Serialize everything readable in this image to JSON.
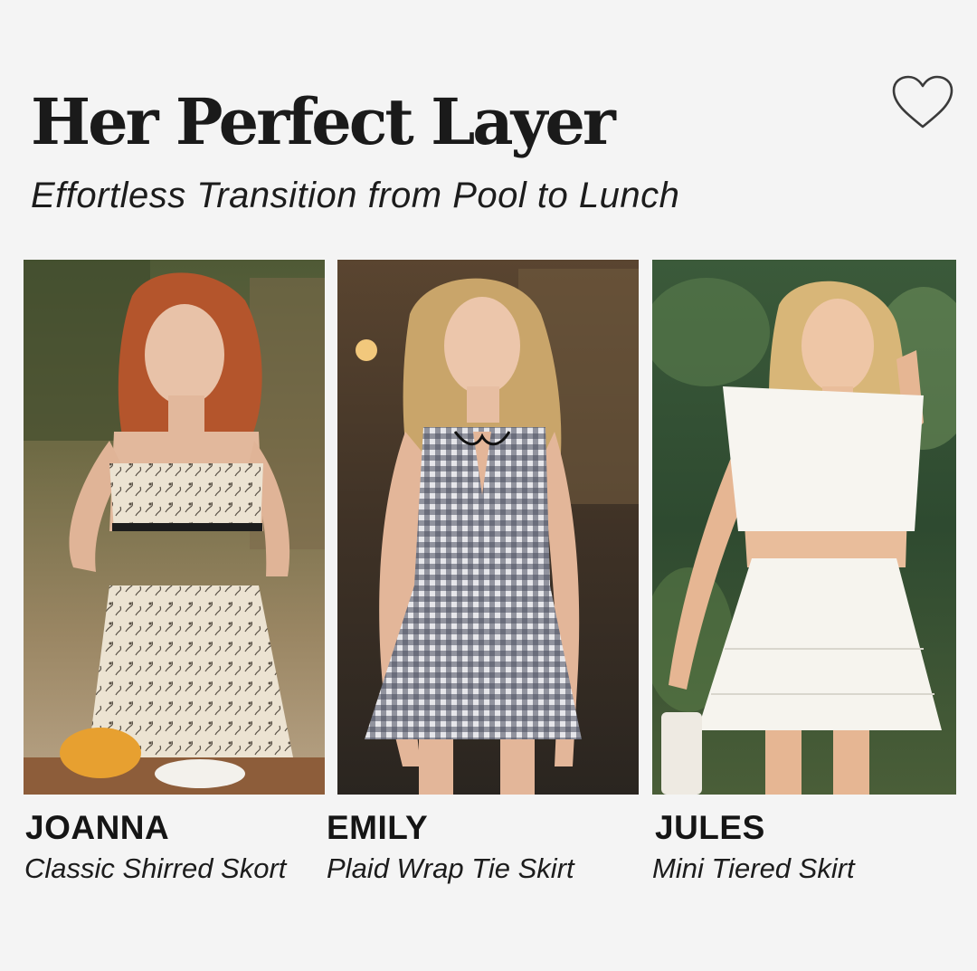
{
  "header": {
    "title": "Her Perfect Layer",
    "subtitle": "Effortless Transition from Pool to Lunch"
  },
  "favorite": {
    "icon": "heart-outline-icon",
    "active": false
  },
  "products": [
    {
      "name": "JOANNA",
      "description": "Classic Shirred Skort",
      "image": "model-floral-print-set-photo"
    },
    {
      "name": "EMILY",
      "description": "Plaid Wrap Tie Skirt",
      "image": "model-gingham-dress-photo"
    },
    {
      "name": "JULES",
      "description": "Mini Tiered Skirt",
      "image": "model-white-tiered-set-photo"
    }
  ],
  "colors": {
    "background": "#f4f4f4",
    "text": "#1c1c1c"
  }
}
